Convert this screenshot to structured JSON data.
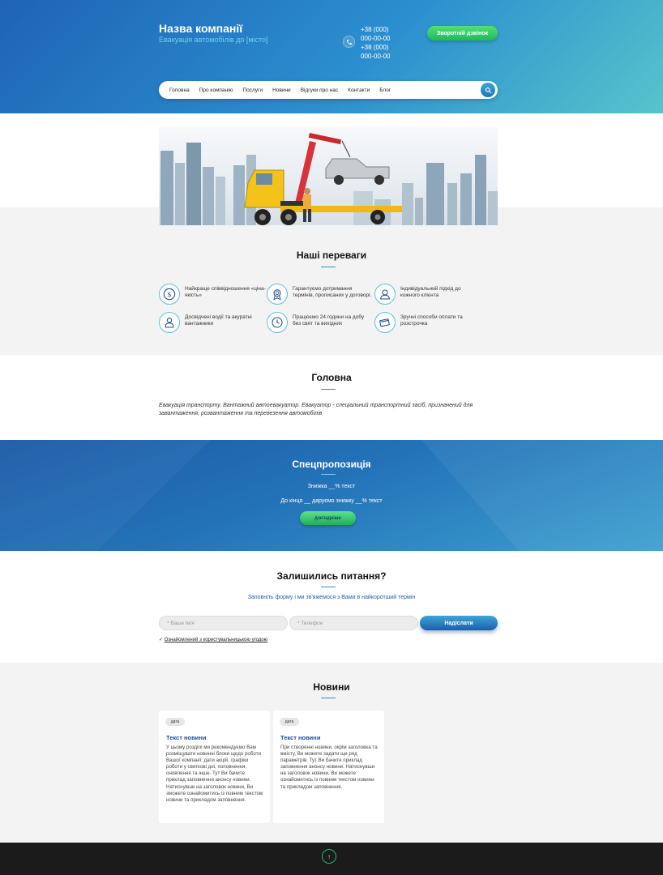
{
  "header": {
    "company_name": "Назва компанії",
    "tagline": "Евакуація автомобілів до [місто]",
    "phones": [
      "+38 (000)",
      "000-00-00",
      "+38 (000)",
      "000-00-00"
    ],
    "callback_label": "Зворотній дзвінок"
  },
  "nav": {
    "items": [
      "Головна",
      "Про компанію",
      "Послуги",
      "Новини",
      "Відгуки про нас",
      "Контакти",
      "Блог"
    ]
  },
  "advantages": {
    "title": "Наші переваги",
    "items": [
      {
        "icon": "dollar-icon",
        "text": "Найкраще співвідношення «ціна-якість»"
      },
      {
        "icon": "medal-icon",
        "text": "Гарантуємо дотримання термінів, прописаних у договорі."
      },
      {
        "icon": "user-icon",
        "text": "Індивідуальний підхід до кожного клієнта"
      },
      {
        "icon": "driver-icon",
        "text": "Досвідчені водії та акуратні вантажники"
      },
      {
        "icon": "clock-icon",
        "text": "Працюємо 24 години на добу без свят та вихідних"
      },
      {
        "icon": "card-icon",
        "text": "Зручні способи оплати та розстрочка"
      }
    ]
  },
  "main": {
    "title": "Головна",
    "text": "Евакуація транспорту. Вантажний автоевакуатор. Евакуатор - спеціальний транспортний засіб, призначений для завантаження, розвантаження та перевезення автомобілів"
  },
  "special": {
    "title": "Спецпропозиція",
    "line1": "Знижка __% текст",
    "line2": "До кінця __ даруємо знижку __% текст",
    "button": "докладніше"
  },
  "contact": {
    "title": "Залишились питання?",
    "subtitle": "Заповніть форму і ми зв'яжемося з Вами в найкоротший термін",
    "name_placeholder": "* Ваше ім'я",
    "phone_placeholder": "* Телефон",
    "submit": "Надіслати",
    "agree_check": "✓",
    "agree_text": "Ознайомлений з користувальницькою угодою"
  },
  "news": {
    "title": "Новини",
    "cards": [
      {
        "date": "дата",
        "title": "Текст новини",
        "text": "У цьому розділі ми рекомендуємо Вам розміщувати новинні блоки щодо роботи Вашої компанії: дати акцій, графіки роботи у святкові дні, поповнення, оновлення та інше. Тут Ви бачите приклад заповнення анонсу новини. Натиснувши на заголовок новини, Ви зможете ознайомитись із повним текстом новини та прикладом заповнення."
      },
      {
        "date": "дата",
        "title": "Текст новини",
        "text": "При створенні новини, окрім заголовка та вмісту, Ви можете задати ще ряд параметрів. Тут Ви бачите приклад заповнення анонсу новини. Натиснувши на заголовок новини, Ви можете ознайомитись із повним текстом новини та прикладом заповнення."
      }
    ]
  },
  "footer": {
    "up_icon": "arrow-up-icon",
    "up_label": "↑"
  },
  "colors": {
    "brand_blue": "#1f63b5",
    "accent_green": "#21ae5a",
    "accent_cyan": "#57c4cb"
  }
}
